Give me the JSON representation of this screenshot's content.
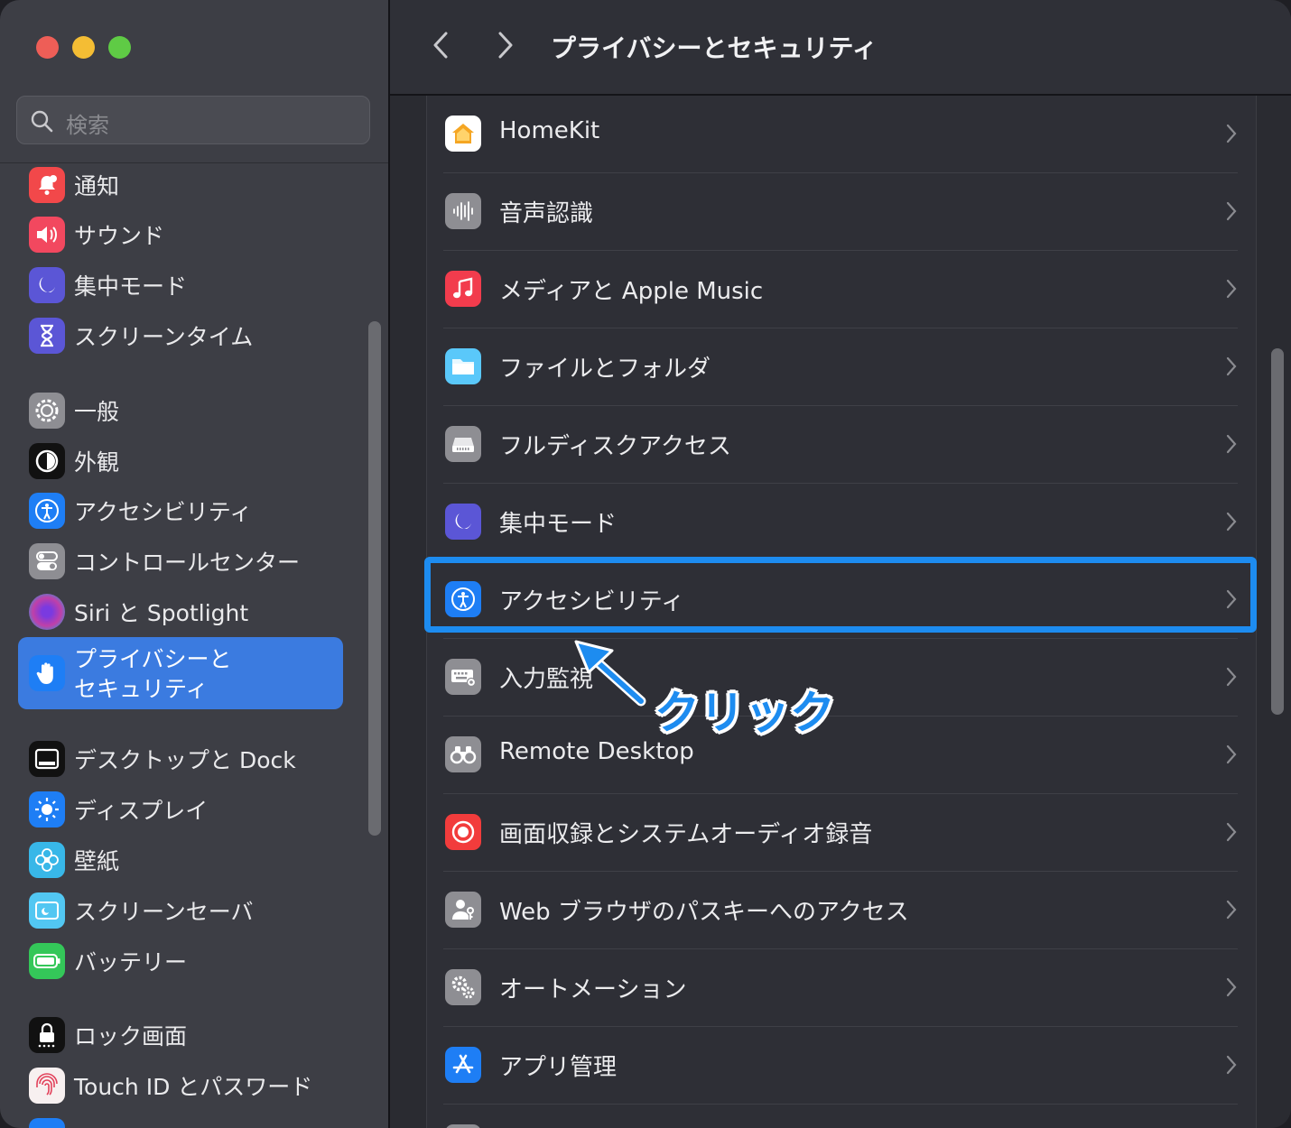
{
  "window": {
    "traffic_lights": {
      "close": "#ee5e57",
      "minimize": "#f4bd34",
      "zoom": "#5fcb45"
    }
  },
  "search": {
    "placeholder": "検索"
  },
  "sidebar": {
    "items": [
      {
        "label": "通知",
        "icon": "bell-icon",
        "color": "#f2484a"
      },
      {
        "label": "サウンド",
        "icon": "speaker-icon",
        "color": "#f2485f"
      },
      {
        "label": "集中モード",
        "icon": "moon-icon",
        "color": "#5b56d6"
      },
      {
        "label": "スクリーンタイム",
        "icon": "hourglass-icon",
        "color": "#5b56d6"
      },
      {
        "label": "一般",
        "icon": "gear-icon",
        "color": "#8e8e93"
      },
      {
        "label": "外観",
        "icon": "appearance-icon",
        "color": "#111111"
      },
      {
        "label": "アクセシビリティ",
        "icon": "accessibility-icon",
        "color": "#1e7ef5"
      },
      {
        "label": "コントロールセンター",
        "icon": "toggles-icon",
        "color": "#8e8e93"
      },
      {
        "label": "Siri と Spotlight",
        "icon": "siri-icon",
        "color": "#c040a8"
      },
      {
        "label": "プライバシーと\nセキュリティ",
        "icon": "hand-icon",
        "color": "#1e7ef5",
        "selected": true
      },
      {
        "label": "デスクトップと Dock",
        "icon": "dock-icon",
        "color": "#111111"
      },
      {
        "label": "ディスプレイ",
        "icon": "sun-icon",
        "color": "#1e7ef5"
      },
      {
        "label": "壁紙",
        "icon": "flower-icon",
        "color": "#38b7e8"
      },
      {
        "label": "スクリーンセーバ",
        "icon": "screensaver-icon",
        "color": "#52c7f2"
      },
      {
        "label": "バッテリー",
        "icon": "battery-icon",
        "color": "#34c759"
      },
      {
        "label": "ロック画面",
        "icon": "lock-icon",
        "color": "#111111"
      },
      {
        "label": "Touch ID とパスワード",
        "icon": "fingerprint-icon",
        "color": "#f7f0f0"
      }
    ]
  },
  "toolbar": {
    "title": "プライバシーとセキュリティ"
  },
  "main": {
    "rows": [
      {
        "label": "HomeKit",
        "icon": "home-icon",
        "color": "#ffffff"
      },
      {
        "label": "音声認識",
        "icon": "waveform-icon",
        "color": "#8e8e93"
      },
      {
        "label": "メディアと Apple Music",
        "icon": "music-note-icon",
        "color": "#f23c4d"
      },
      {
        "label": "ファイルとフォルダ",
        "icon": "folder-icon",
        "color": "#5ac8fa"
      },
      {
        "label": "フルディスクアクセス",
        "icon": "disk-icon",
        "color": "#8e8e93"
      },
      {
        "label": "集中モード",
        "icon": "moon-icon",
        "color": "#5b56d6"
      },
      {
        "label": "アクセシビリティ",
        "icon": "accessibility-icon",
        "color": "#1e7ef5"
      },
      {
        "label": "入力監視",
        "icon": "keyboard-icon",
        "color": "#8e8e93"
      },
      {
        "label": "Remote Desktop",
        "icon": "binoculars-icon",
        "color": "#8e8e93"
      },
      {
        "label": "画面収録とシステムオーディオ録音",
        "icon": "record-icon",
        "color": "#f23c3c"
      },
      {
        "label": "Web ブラウザのパスキーへのアクセス",
        "icon": "person-key-icon",
        "color": "#8e8e93"
      },
      {
        "label": "オートメーション",
        "icon": "gears-icon",
        "color": "#8e8e93"
      },
      {
        "label": "アプリ管理",
        "icon": "app-store-icon",
        "color": "#1e7ef5"
      }
    ]
  },
  "annotation": {
    "text": "クリック",
    "highlight_color": "#1d8cf0"
  }
}
